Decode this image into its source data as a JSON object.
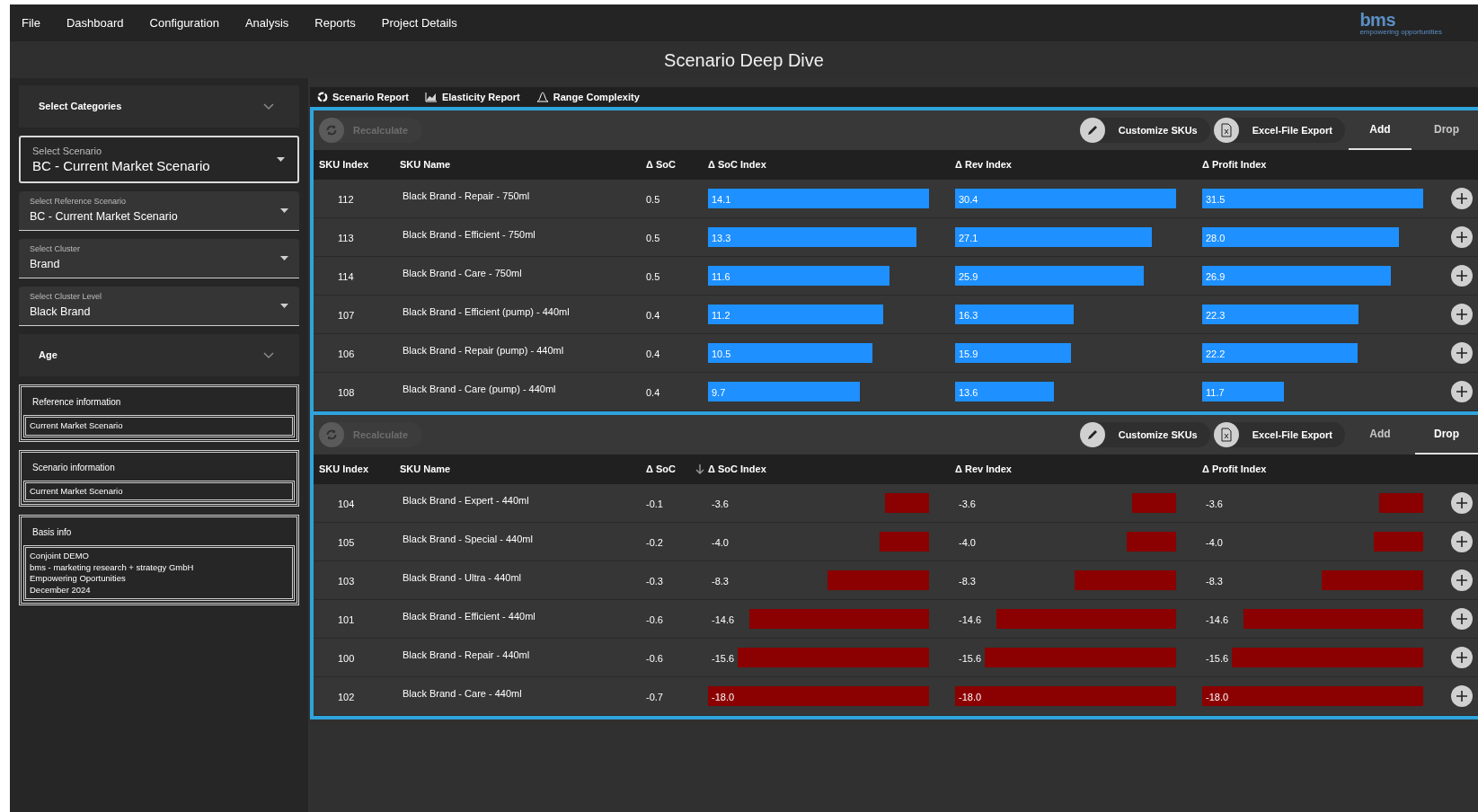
{
  "menu": [
    "File",
    "Dashboard",
    "Configuration",
    "Analysis",
    "Reports",
    "Project Details"
  ],
  "logo": {
    "name": "bms",
    "tagline": "empowering opportunities"
  },
  "page_title": "Scenario Deep Dive",
  "sidebar": [
    {
      "kind": "accordion",
      "label": "Select Categories",
      "expanded": false
    },
    {
      "kind": "select",
      "label": "Select Scenario",
      "value": "BC - Current Market Scenario"
    },
    {
      "kind": "select",
      "label": "Select Reference Scenario",
      "value": "BC - Current Market Scenario"
    },
    {
      "kind": "select",
      "label": "Select Cluster",
      "value": "Brand"
    },
    {
      "kind": "select",
      "label": "Select Cluster Level",
      "value": "Black Brand"
    },
    {
      "kind": "accordion",
      "label": "Age",
      "expanded": false
    },
    {
      "kind": "info",
      "label": "Reference information",
      "lines": [
        "Current Market Scenario"
      ]
    },
    {
      "kind": "info",
      "label": "Scenario information",
      "lines": [
        "Current Market Scenario"
      ]
    },
    {
      "kind": "info",
      "label": "Basis info",
      "lines": [
        "Conjoint DEMO",
        "bms - marketing research + strategy GmbH",
        "Empowering Oportunities",
        "December 2024"
      ]
    }
  ],
  "report_tabs": [
    {
      "label": "Scenario Report"
    },
    {
      "label": "Elasticity Report"
    },
    {
      "label": "Range Complexity"
    }
  ],
  "panels": [
    {
      "recalculate": {
        "label": "Recalculate",
        "disabled": true
      },
      "buttons": [
        {
          "label": "Customize SKUs"
        },
        {
          "label": "Excel-File Export"
        }
      ],
      "tabs": [
        {
          "label": "Add",
          "selected": true
        },
        {
          "label": "Drop",
          "selected": false
        }
      ],
      "columns": [
        {
          "label": "SKU Index",
          "sorted": false
        },
        {
          "label": "SKU Name",
          "sorted": false
        },
        {
          "label": "Δ SoC",
          "sorted": false
        },
        {
          "label": "Δ SoC Index",
          "sorted": false
        },
        {
          "label": "Δ Rev Index",
          "sorted": false
        },
        {
          "label": "Δ Profit Index",
          "sorted": false
        }
      ],
      "rows": [
        {
          "index": "112",
          "name": "Black Brand - Repair - 750ml",
          "soc": "0.5",
          "bars": [
            {
              "value": "14.1"
            },
            {
              "value": "30.4"
            },
            {
              "value": "31.5"
            }
          ]
        },
        {
          "index": "113",
          "name": "Black Brand - Efficient - 750ml",
          "soc": "0.5",
          "bars": [
            {
              "value": "13.3"
            },
            {
              "value": "27.1"
            },
            {
              "value": "28.0"
            }
          ]
        },
        {
          "index": "114",
          "name": "Black Brand - Care - 750ml",
          "soc": "0.5",
          "bars": [
            {
              "value": "11.6"
            },
            {
              "value": "25.9"
            },
            {
              "value": "26.9"
            }
          ]
        },
        {
          "index": "107",
          "name": "Black Brand - Efficient (pump) - 440ml",
          "soc": "0.4",
          "bars": [
            {
              "value": "11.2"
            },
            {
              "value": "16.3"
            },
            {
              "value": "22.3"
            }
          ]
        },
        {
          "index": "106",
          "name": "Black Brand - Repair (pump) - 440ml",
          "soc": "0.4",
          "bars": [
            {
              "value": "10.5"
            },
            {
              "value": "15.9"
            },
            {
              "value": "22.2"
            }
          ]
        },
        {
          "index": "108",
          "name": "Black Brand - Care (pump) - 440ml",
          "soc": "0.4",
          "bars": [
            {
              "value": "9.7"
            },
            {
              "value": "13.6"
            },
            {
              "value": "11.7"
            }
          ]
        }
      ]
    },
    {
      "recalculate": {
        "label": "Recalculate",
        "disabled": true
      },
      "buttons": [
        {
          "label": "Customize SKUs"
        },
        {
          "label": "Excel-File Export"
        }
      ],
      "tabs": [
        {
          "label": "Add",
          "selected": false
        },
        {
          "label": "Drop",
          "selected": true
        }
      ],
      "columns": [
        {
          "label": "SKU Index",
          "sorted": false
        },
        {
          "label": "SKU Name",
          "sorted": false
        },
        {
          "label": "Δ SoC",
          "sorted": false
        },
        {
          "label": "Δ SoC Index",
          "sorted": true
        },
        {
          "label": "Δ Rev Index",
          "sorted": false
        },
        {
          "label": "Δ Profit Index",
          "sorted": false
        }
      ],
      "rows": [
        {
          "index": "104",
          "name": "Black Brand - Expert - 440ml",
          "soc": "-0.1",
          "bars": [
            {
              "value": "-3.6"
            },
            {
              "value": "-3.6"
            },
            {
              "value": "-3.6"
            }
          ]
        },
        {
          "index": "105",
          "name": "Black Brand - Special - 440ml",
          "soc": "-0.2",
          "bars": [
            {
              "value": "-4.0"
            },
            {
              "value": "-4.0"
            },
            {
              "value": "-4.0"
            }
          ]
        },
        {
          "index": "103",
          "name": "Black Brand - Ultra - 440ml",
          "soc": "-0.3",
          "bars": [
            {
              "value": "-8.3"
            },
            {
              "value": "-8.3"
            },
            {
              "value": "-8.3"
            }
          ]
        },
        {
          "index": "101",
          "name": "Black Brand - Efficient - 440ml",
          "soc": "-0.6",
          "bars": [
            {
              "value": "-14.6"
            },
            {
              "value": "-14.6"
            },
            {
              "value": "-14.6"
            }
          ]
        },
        {
          "index": "100",
          "name": "Black Brand - Repair - 440ml",
          "soc": "-0.6",
          "bars": [
            {
              "value": "-15.6"
            },
            {
              "value": "-15.6"
            },
            {
              "value": "-15.6"
            }
          ]
        },
        {
          "index": "102",
          "name": "Black Brand - Care - 440ml",
          "soc": "-0.7",
          "bars": [
            {
              "value": "-18.0"
            },
            {
              "value": "-18.0"
            },
            {
              "value": "-18.0"
            }
          ]
        }
      ]
    }
  ]
}
